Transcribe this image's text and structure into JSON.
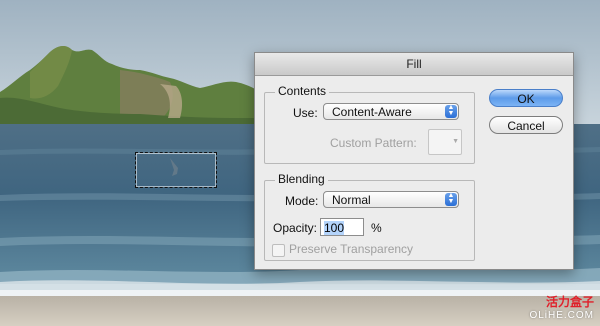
{
  "dialog": {
    "title": "Fill",
    "ok_label": "OK",
    "cancel_label": "Cancel",
    "contents": {
      "legend": "Contents",
      "use_label": "Use:",
      "use_value": "Content-Aware",
      "custom_pattern_label": "Custom Pattern:"
    },
    "blending": {
      "legend": "Blending",
      "mode_label": "Mode:",
      "mode_value": "Normal",
      "opacity_label": "Opacity:",
      "opacity_value": "100",
      "opacity_unit": "%",
      "preserve_transparency_label": "Preserve Transparency"
    }
  },
  "watermark": {
    "chinese": "活力盒子",
    "latin": "OLiHE.COM"
  }
}
